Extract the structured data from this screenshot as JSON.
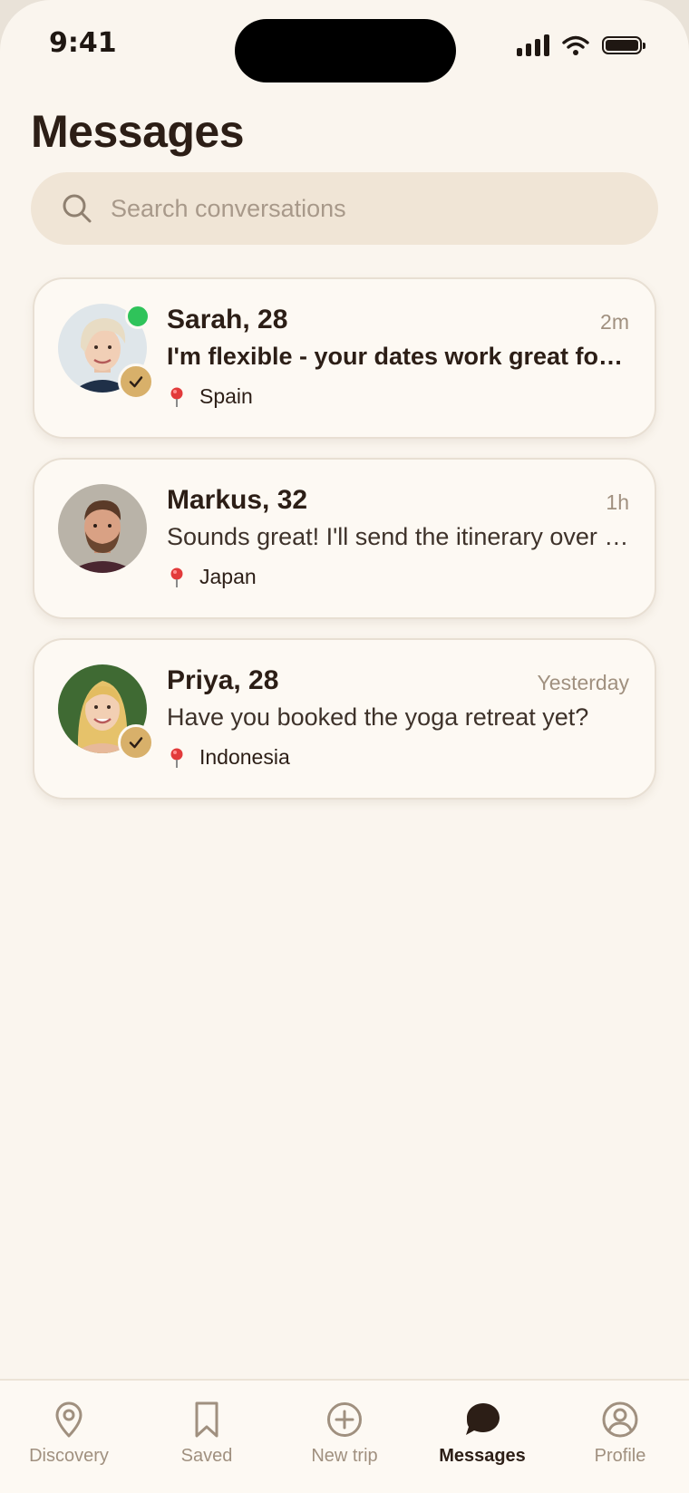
{
  "status_bar": {
    "time": "9:41"
  },
  "header": {
    "title": "Messages"
  },
  "search": {
    "placeholder": "Search conversations"
  },
  "conversations": [
    {
      "name": "Sarah, 28",
      "time": "2m",
      "preview": "I'm flexible - your dates work great for me",
      "location": "Spain",
      "online": true,
      "verified": true,
      "unread": true
    },
    {
      "name": "Markus, 32",
      "time": "1h",
      "preview": "Sounds great! I'll send the itinerary over tonight",
      "location": "Japan",
      "online": false,
      "verified": false,
      "unread": false
    },
    {
      "name": "Priya, 28",
      "time": "Yesterday",
      "preview": "Have you booked the yoga retreat yet?",
      "location": "Indonesia",
      "online": false,
      "verified": true,
      "unread": false
    }
  ],
  "tabbar": {
    "items": [
      {
        "label": "Discovery",
        "icon": "location-pin-icon"
      },
      {
        "label": "Saved",
        "icon": "bookmark-icon"
      },
      {
        "label": "New trip",
        "icon": "plus-circle-icon"
      },
      {
        "label": "Messages",
        "icon": "chat-bubble-icon",
        "active": true
      },
      {
        "label": "Profile",
        "icon": "user-circle-icon"
      }
    ]
  },
  "colors": {
    "accent": "#d8b06a",
    "online": "#2fc35a",
    "background": "#faf5ee",
    "text": "#2c1e16"
  }
}
